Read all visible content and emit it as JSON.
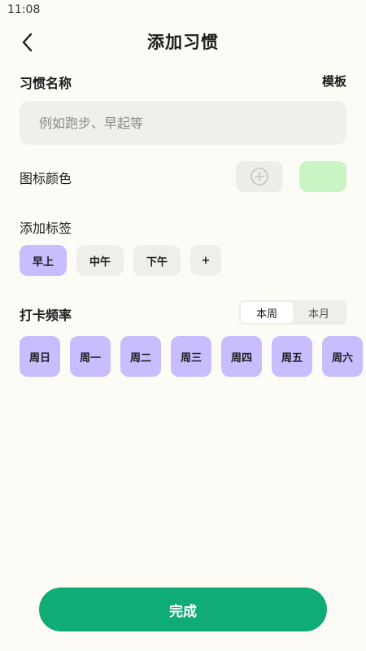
{
  "status_bar": {
    "time": "11:08"
  },
  "header": {
    "title": "添加习惯",
    "back_icon": "chevron-left-icon"
  },
  "habit_name": {
    "label": "习惯名称",
    "template_label": "模板",
    "placeholder": "例如跑步、早起等",
    "value": ""
  },
  "icon_color": {
    "label": "图标颜色",
    "icon_button": "plus-circle-icon",
    "selected_color": "#c9f5c5"
  },
  "tags": {
    "label": "添加标签",
    "items": [
      {
        "label": "早上",
        "selected": true
      },
      {
        "label": "中午",
        "selected": false
      },
      {
        "label": "下午",
        "selected": false
      }
    ],
    "add_label": "+"
  },
  "frequency": {
    "label": "打卡频率",
    "period_options": [
      "本周",
      "本月"
    ],
    "selected_period": "本周",
    "days": [
      "周日",
      "周一",
      "周二",
      "周三",
      "周四",
      "周五",
      "周六"
    ]
  },
  "footer": {
    "done_label": "完成"
  },
  "colors": {
    "accent": "#0fac78",
    "selected_chip": "#c8bdff",
    "background": "#fcfbf6"
  }
}
